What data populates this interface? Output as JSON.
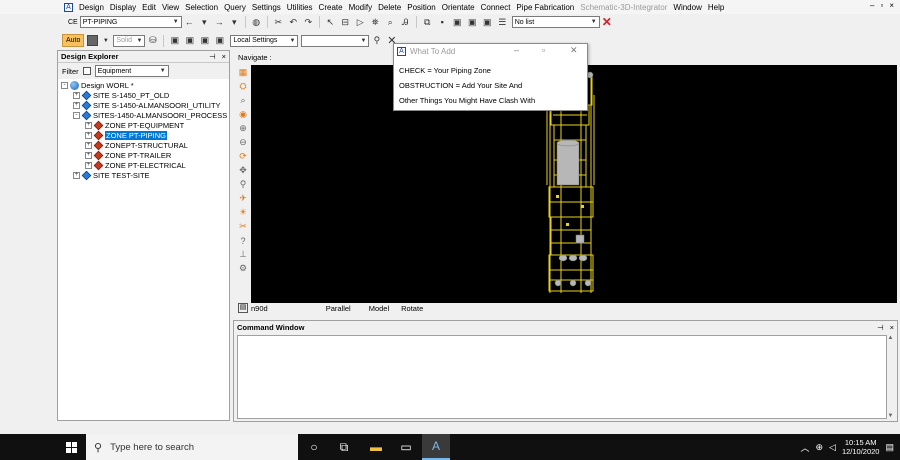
{
  "menubar": {
    "items": [
      "Design",
      "Display",
      "Edit",
      "View",
      "Selection",
      "Query",
      "Settings",
      "Utilities",
      "Create",
      "Modify",
      "Delete",
      "Position",
      "Orientate",
      "Connect",
      "Pipe Fabrication",
      "Schematic-3D-Integrator",
      "Window",
      "Help"
    ],
    "disabled_item": "Schematic-3D-Integrator"
  },
  "toolbar1": {
    "ce_label": "CE",
    "ce_value": "PT-PIPING",
    "list_value": "No list"
  },
  "toolbar2": {
    "auto_label": "Auto",
    "solid_label": "Solid",
    "settings_value": "Local Settings"
  },
  "explorer": {
    "title": "Design Explorer",
    "filter_label": "Filter",
    "filter_value": "Equipment",
    "tree": [
      {
        "label": "Design WORL *",
        "icon": "globe-icon",
        "expander": "-"
      },
      {
        "label": "SITE S-1450_PT_OLD",
        "icon": "site-icon",
        "expander": "+"
      },
      {
        "label": "SITE S-1450-ALMANSOORI_UTILITY",
        "icon": "site-icon",
        "expander": "+"
      },
      {
        "label": "SITES-1450-ALMANSOORI_PROCESS",
        "icon": "site-icon",
        "expander": "-"
      },
      {
        "label": "ZONE PT-EQUIPMENT",
        "icon": "zone-icon",
        "expander": "+"
      },
      {
        "label": "ZONE PT-PIPING",
        "icon": "zone-icon",
        "expander": "+",
        "selected": true
      },
      {
        "label": "ZONEPT-STRUCTURAL",
        "icon": "zone-icon",
        "expander": "+"
      },
      {
        "label": "ZONE PT-TRAILER",
        "icon": "zone-icon",
        "expander": "+"
      },
      {
        "label": "ZONE PT-ELECTRICAL",
        "icon": "zone-icon",
        "expander": "+"
      },
      {
        "label": "SITE TEST-SITE",
        "icon": "site-icon",
        "expander": "+"
      }
    ]
  },
  "viewport": {
    "nav_label": "Navigate :",
    "status": {
      "view_dir": "n90d",
      "projection": "Parallel",
      "mode": "Model",
      "action": "Rotate"
    }
  },
  "command_window": {
    "title": "Command Window"
  },
  "dialog": {
    "title": "What To Add",
    "lines": [
      "CHECK = Your Piping Zone",
      "OBSTRUCTION = Add Your Site And",
      "Other Things You Might Have Clash With"
    ]
  },
  "taskbar": {
    "search_placeholder": "Type here to search",
    "time": "10:15 AM",
    "date": "12/10/2020"
  },
  "colors": {
    "viewport_bg": "#000000",
    "model_yellow": "#e8d21a",
    "selection_blue": "#0078d7",
    "auto_orange": "#f7c15f"
  }
}
